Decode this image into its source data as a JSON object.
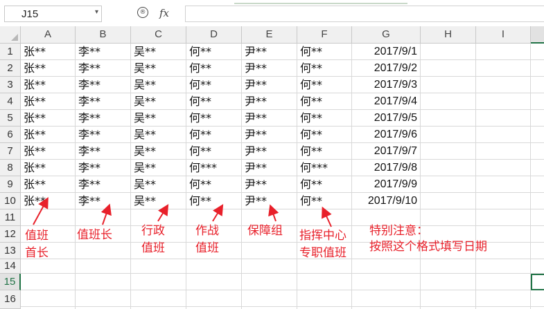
{
  "name_box": "J15",
  "formula_bar": {
    "fx_label": "fx",
    "zoom_icon": "magnify-icon",
    "value": ""
  },
  "columns": [
    "A",
    "B",
    "C",
    "D",
    "E",
    "F",
    "G",
    "H",
    "I"
  ],
  "rows": [
    "1",
    "2",
    "3",
    "4",
    "5",
    "6",
    "7",
    "8",
    "9",
    "10",
    "11",
    "12",
    "13",
    "14",
    "15",
    "16"
  ],
  "data_rows": [
    [
      "张**",
      "李**",
      "吴**",
      "何**",
      "尹**",
      "何**",
      "2017/9/1"
    ],
    [
      "张**",
      "李**",
      "吴**",
      "何**",
      "尹**",
      "何**",
      "2017/9/2"
    ],
    [
      "张**",
      "李**",
      "吴**",
      "何**",
      "尹**",
      "何**",
      "2017/9/3"
    ],
    [
      "张**",
      "李**",
      "吴**",
      "何**",
      "尹**",
      "何**",
      "2017/9/4"
    ],
    [
      "张**",
      "李**",
      "吴**",
      "何**",
      "尹**",
      "何**",
      "2017/9/5"
    ],
    [
      "张**",
      "李**",
      "吴**",
      "何**",
      "尹**",
      "何**",
      "2017/9/6"
    ],
    [
      "张**",
      "李**",
      "吴**",
      "何**",
      "尹**",
      "何**",
      "2017/9/7"
    ],
    [
      "张**",
      "李**",
      "吴**",
      "何***",
      "尹**",
      "何***",
      "2017/9/8"
    ],
    [
      "张**",
      "李**",
      "吴**",
      "何**",
      "尹**",
      "何**",
      "2017/9/9"
    ],
    [
      "张**",
      "李**",
      "吴**",
      "何**",
      "尹**",
      "何**",
      "2017/9/10"
    ]
  ],
  "annotations": {
    "a1": "值班",
    "a2": "首长",
    "b1": "值班长",
    "c1": "行政",
    "c2": "值班",
    "d1": "作战",
    "d2": "值班",
    "e1": "保障组",
    "f1": "指挥中心",
    "f2": "专职值班",
    "g1": "特别注意：",
    "g2": "按照这个格式填写日期"
  },
  "colors": {
    "accent": "#217346",
    "annotation": "#e8202a"
  }
}
